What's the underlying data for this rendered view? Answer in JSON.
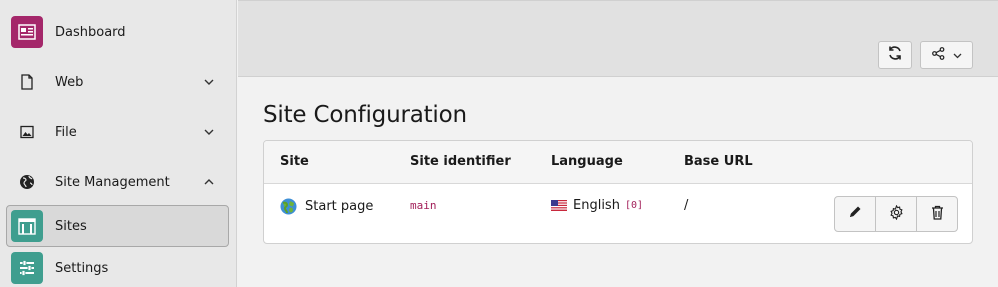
{
  "sidebar": {
    "items": [
      {
        "label": "Dashboard",
        "icon": "dashboard-icon",
        "color": "#a4276a"
      },
      {
        "label": "Web",
        "icon": "page-icon"
      },
      {
        "label": "File",
        "icon": "image-icon"
      },
      {
        "label": "Site Management",
        "icon": "globe-icon"
      },
      {
        "label": "Sites",
        "icon": "sites-icon",
        "color": "#3f9e8f",
        "active": true
      },
      {
        "label": "Settings",
        "icon": "settings-icon",
        "color": "#3f9e8f"
      }
    ]
  },
  "toolbar": {
    "reload_icon": "refresh-icon",
    "share_icon": "share-icon"
  },
  "main": {
    "title": "Site Configuration",
    "table": {
      "columns": [
        "Site",
        "Site identifier",
        "Language",
        "Base URL"
      ],
      "rows": [
        {
          "site": "Start page",
          "identifier": "main",
          "language": "English",
          "language_id": "[0]",
          "base_url": "/",
          "actions": [
            "edit-icon",
            "gear-icon",
            "trash-icon"
          ]
        }
      ]
    }
  },
  "colors": {
    "accent_magenta": "#a4276a",
    "accent_teal": "#3f9e8f",
    "code_text": "#a3205a"
  }
}
